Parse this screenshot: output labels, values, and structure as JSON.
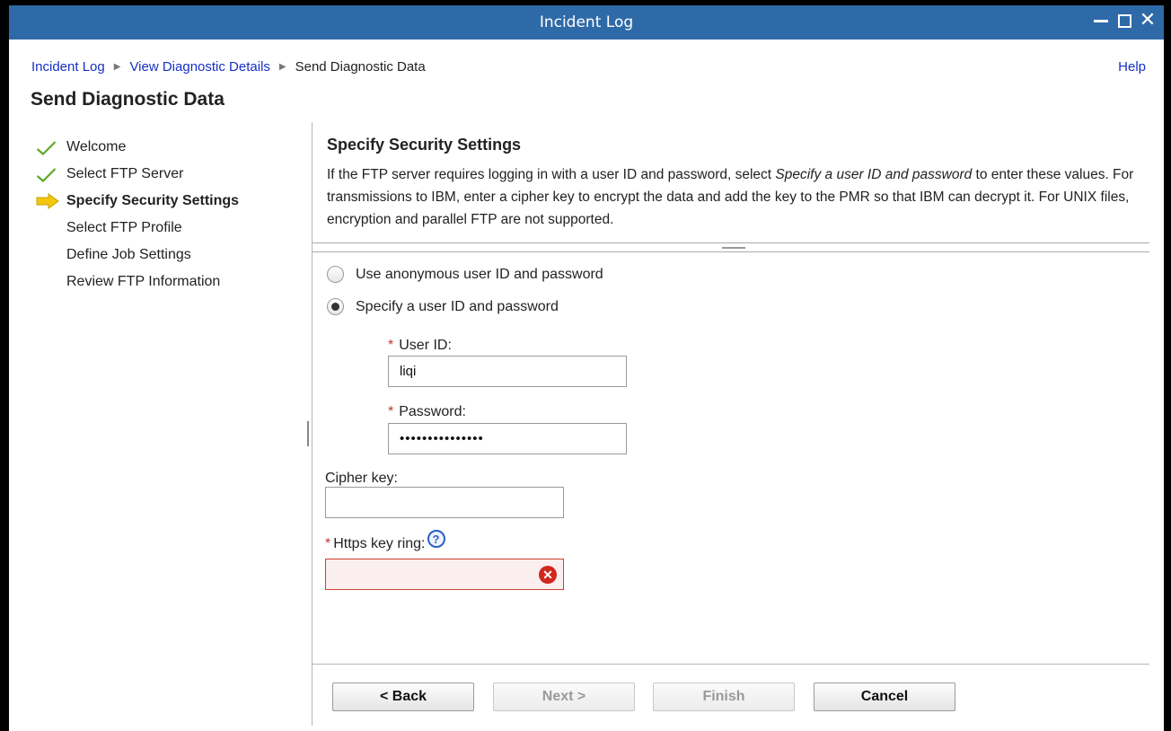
{
  "window": {
    "title": "Incident Log"
  },
  "breadcrumb": {
    "items": [
      "Incident Log",
      "View Diagnostic Details"
    ],
    "current": "Send Diagnostic Data"
  },
  "help_label": "Help",
  "page_title": "Send Diagnostic Data",
  "steps": [
    {
      "label": "Welcome",
      "state": "done"
    },
    {
      "label": "Select FTP Server",
      "state": "done"
    },
    {
      "label": "Specify Security Settings",
      "state": "active"
    },
    {
      "label": "Select FTP Profile",
      "state": "pending"
    },
    {
      "label": "Define Job Settings",
      "state": "pending"
    },
    {
      "label": "Review FTP Information",
      "state": "pending"
    }
  ],
  "section": {
    "title": "Specify Security Settings",
    "desc_before": "If the FTP server requires logging in with a user ID and password, select ",
    "desc_emphasis": "Specify a user ID and password",
    "desc_after": " to enter these values. For transmissions to IBM, enter a cipher key to encrypt the data and add the key to the PMR so that IBM can decrypt it. For UNIX files, encryption and parallel FTP are not supported."
  },
  "options": {
    "anonymous": {
      "label": "Use anonymous user ID and password",
      "selected": false
    },
    "specify": {
      "label": "Specify a user ID and password",
      "selected": true
    }
  },
  "fields": {
    "required_mark": "*",
    "user_id": {
      "label": "User ID:",
      "value": "liqi"
    },
    "password": {
      "label": "Password:",
      "value": "•••••••••••••••"
    },
    "cipher_key": {
      "label": "Cipher key:",
      "value": ""
    },
    "https_key_ring": {
      "label": "Https key ring:",
      "value": "",
      "error": true
    }
  },
  "icons": {
    "help": "?",
    "error": "✕"
  },
  "buttons": {
    "back": "< Back",
    "next": "Next >",
    "finish": "Finish",
    "cancel": "Cancel"
  },
  "colors": {
    "titlebar": "#2f6aa8",
    "link": "#1530c4",
    "check": "#5aa827",
    "current_arrow": "#f2c70c",
    "error": "#d0281e"
  }
}
